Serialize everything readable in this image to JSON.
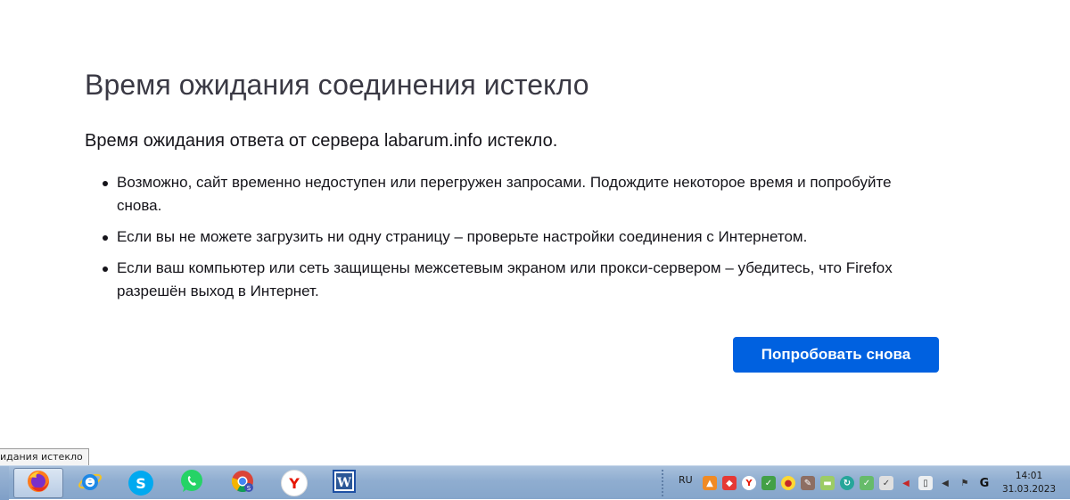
{
  "error": {
    "title": "Время ожидания соединения истекло",
    "subtitle": "Время ожидания ответа от сервера labarum.info истекло.",
    "bullets": [
      "Возможно, сайт временно недоступен или перегружен запросами. Подождите некоторое время и попробуйте снова.",
      "Если вы не можете загрузить ни одну страницу – проверьте настройки соединения с Интернетом.",
      "Если ваш компьютер или сеть защищены межсетевым экраном или прокси-сервером – убедитесь, что Firefox разрешён выход в Интернет."
    ],
    "retry_label": "Попробовать снова"
  },
  "tooltip": "идания истекло",
  "taskbar": {
    "apps": [
      {
        "name": "firefox-icon",
        "active": true
      },
      {
        "name": "internet-explorer-icon",
        "active": false
      },
      {
        "name": "skype-icon",
        "active": false
      },
      {
        "name": "whatsapp-icon",
        "active": false
      },
      {
        "name": "chrome-icon",
        "active": false
      },
      {
        "name": "yandex-browser-icon",
        "active": false
      },
      {
        "name": "microsoft-word-icon",
        "active": false
      }
    ],
    "language": "RU",
    "time": "14:01",
    "date": "31.03.2023"
  },
  "colors": {
    "accent": "#0061e0",
    "taskbar": "#8fadd0"
  }
}
